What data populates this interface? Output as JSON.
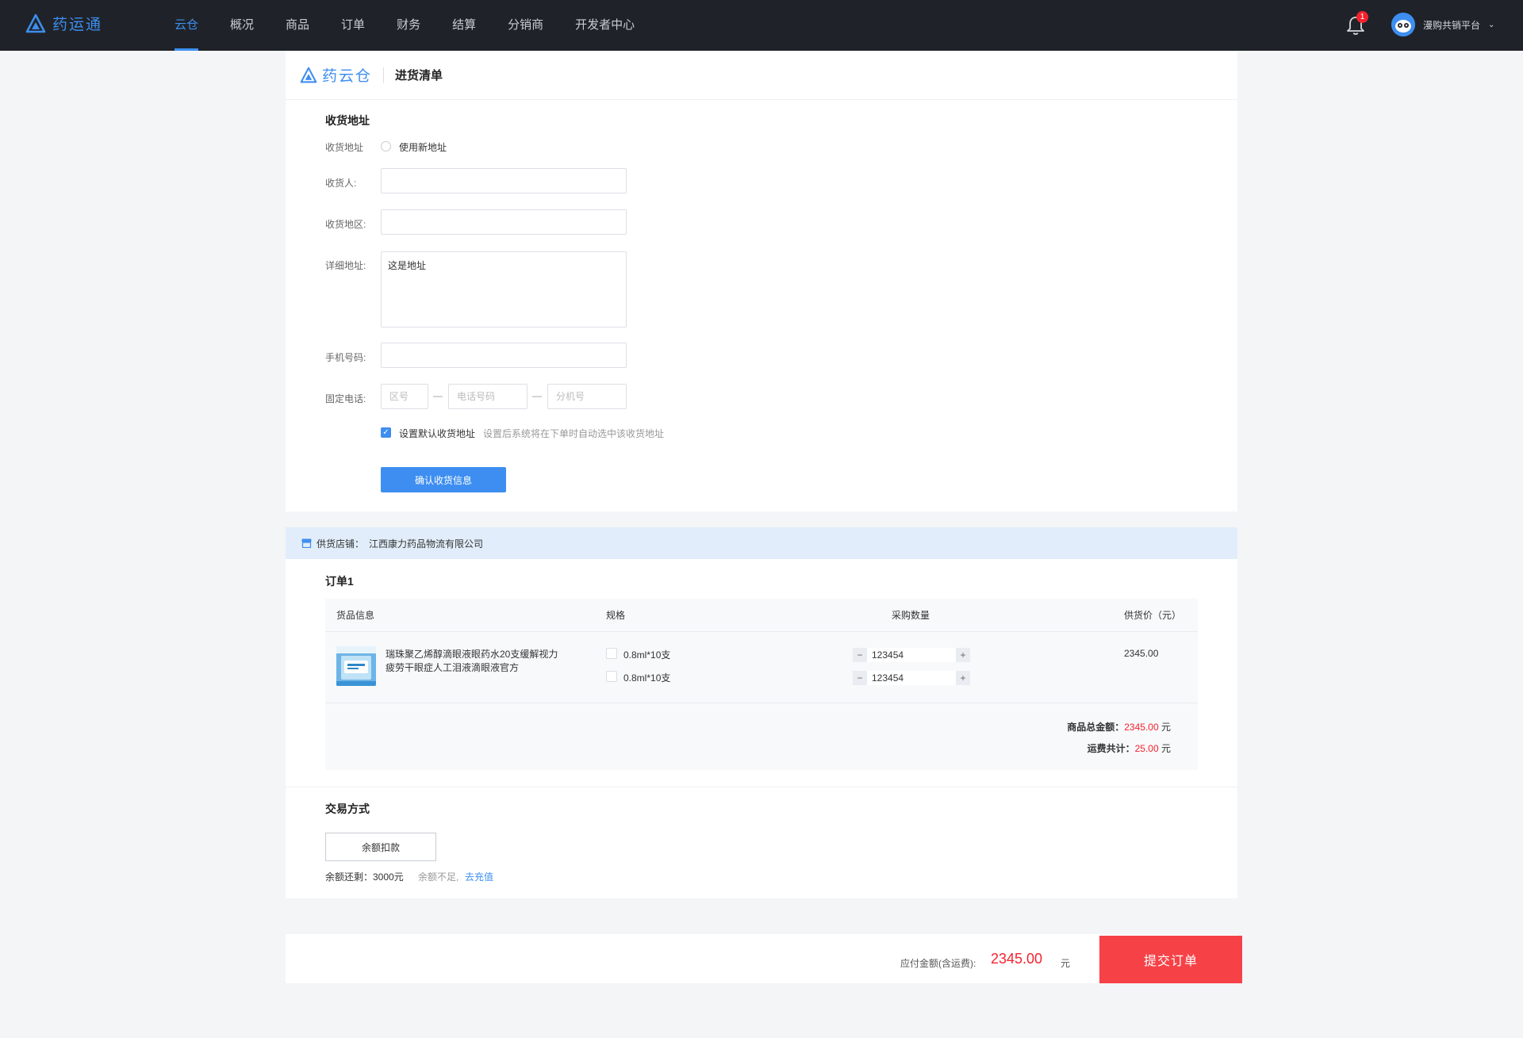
{
  "brand": {
    "name": "药运通",
    "sub_name": "药云仓"
  },
  "nav": [
    "云仓",
    "概况",
    "商品",
    "订单",
    "财务",
    "结算",
    "分销商",
    "开发者中心"
  ],
  "notifications": {
    "count": "1"
  },
  "user": {
    "name": "漫购共销平台"
  },
  "page": {
    "title": "进货清单"
  },
  "address": {
    "section_title": "收货地址",
    "address_label": "收货地址",
    "new_address": "使用新地址",
    "receiver_label": "收货人:",
    "region_label": "收货地区:",
    "detail_label": "详细地址:",
    "detail_value": "这是地址",
    "mobile_label": "手机号码:",
    "phone_label": "固定电话:",
    "area_code_ph": "区号",
    "phone_ph": "电话号码",
    "ext_ph": "分机号",
    "default_label": "设置默认收货地址",
    "default_hint": "设置后系统将在下单时自动选中该收货地址",
    "confirm_button": "确认收货信息"
  },
  "order": {
    "store_label": "供货店铺：",
    "store_name": "江西康力药品物流有限公司",
    "title": "订单1",
    "columns": [
      "货品信息",
      "规格",
      "采购数量",
      "供货价（元）"
    ],
    "item": {
      "name": "瑞珠聚乙烯醇滴眼液眼药水20支缓解视力疲劳干眼症人工泪液滴眼液官方",
      "specs": [
        "0.8ml*10支",
        "0.8ml*10支"
      ],
      "quantities": [
        "123454",
        "123454"
      ],
      "price": "2345.00"
    },
    "goods_total_label": "商品总金额：",
    "goods_total": "2345.00",
    "freight_label": "运费共计：",
    "freight": "25.00",
    "currency": "元"
  },
  "payment": {
    "section_title": "交易方式",
    "method": "余额扣款",
    "balance_label": "余额还剩：",
    "balance": "3000元",
    "insufficient": "余额不足,",
    "recharge": "去充值"
  },
  "footer": {
    "payable_label": "应付金额(含运费):",
    "payable": "2345.00",
    "currency": "元",
    "submit": "提交订单"
  },
  "colors": {
    "accent": "#3d8ef0",
    "danger": "#f5222d",
    "submit": "#f64247",
    "topbar": "#1f2329"
  }
}
